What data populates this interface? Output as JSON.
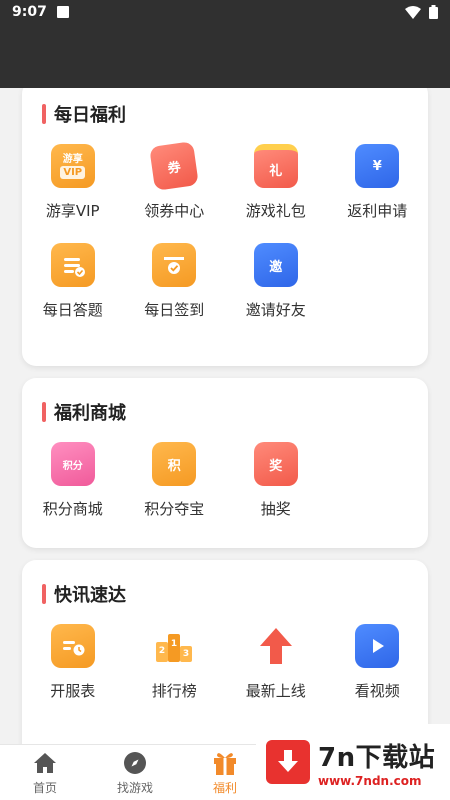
{
  "status": {
    "time": "9:07"
  },
  "sections": [
    {
      "title": "每日福利",
      "items": [
        {
          "label": "游享VIP",
          "icon": "vip-badge-icon",
          "badge_top": "游享",
          "badge_bottom": "VIP"
        },
        {
          "label": "领券中心",
          "icon": "coupon-icon",
          "badge": "券"
        },
        {
          "label": "游戏礼包",
          "icon": "gift-box-icon",
          "badge": "礼"
        },
        {
          "label": "返利申请",
          "icon": "rebate-wallet-icon",
          "badge": "¥"
        },
        {
          "label": "每日答题",
          "icon": "quiz-clipboard-icon"
        },
        {
          "label": "每日签到",
          "icon": "calendar-check-icon"
        },
        {
          "label": "邀请好友",
          "icon": "invite-share-icon",
          "badge": "邀"
        }
      ]
    },
    {
      "title": "福利商城",
      "items": [
        {
          "label": "积分商城",
          "icon": "shopping-bag-icon",
          "badge": "积分"
        },
        {
          "label": "积分夺宝",
          "icon": "treasure-icon",
          "badge": "积"
        },
        {
          "label": "抽奖",
          "icon": "lottery-icon",
          "badge": "奖"
        }
      ]
    },
    {
      "title": "快讯速达",
      "items": [
        {
          "label": "开服表",
          "icon": "server-schedule-icon"
        },
        {
          "label": "排行榜",
          "icon": "ranking-podium-icon"
        },
        {
          "label": "最新上线",
          "icon": "arrow-up-icon"
        },
        {
          "label": "看视频",
          "icon": "video-play-icon"
        }
      ]
    }
  ],
  "nav": [
    {
      "label": "首页",
      "icon": "home-icon",
      "active": false
    },
    {
      "label": "找游戏",
      "icon": "compass-icon",
      "active": false
    },
    {
      "label": "福利",
      "icon": "gift-icon",
      "active": true
    }
  ],
  "watermark": {
    "title": "7n下载站",
    "url": "www.7ndn.com"
  },
  "colors": {
    "accent": "#f28a2a",
    "section_bar": "#f06262",
    "header_bg": "#303030"
  }
}
